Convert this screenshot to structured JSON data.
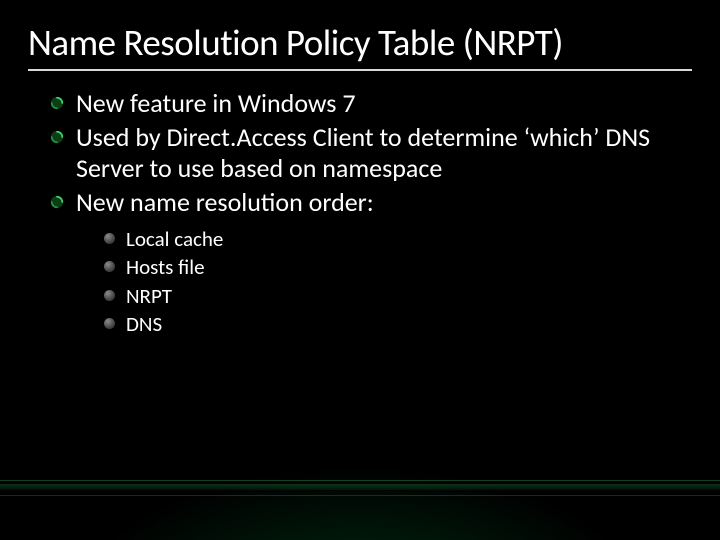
{
  "title": "Name Resolution Policy Table (NRPT)",
  "bullets": [
    {
      "text": "New feature in Windows 7"
    },
    {
      "text": "Used by Direct.Access Client to determine ‘which’ DNS Server to use based on namespace"
    },
    {
      "text": "New name resolution order:"
    }
  ],
  "sub_bullets": [
    "Local cache",
    "Hosts file",
    "NRPT",
    "DNS"
  ],
  "theme": {
    "accent": "#1f8a3b",
    "background": "#000000",
    "text": "#ffffff"
  }
}
